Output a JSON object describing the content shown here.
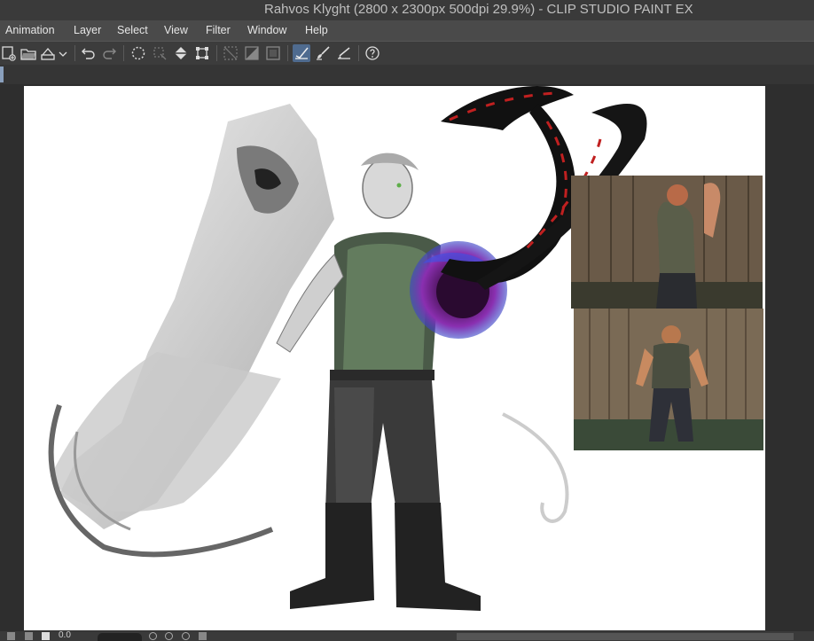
{
  "window": {
    "title": "Rahvos Klyght (2800 x 2300px 500dpi 29.9%)  - CLIP STUDIO PAINT EX"
  },
  "menu": {
    "items": [
      "Animation",
      "Layer",
      "Select",
      "View",
      "Filter",
      "Window",
      "Help"
    ]
  },
  "toolbar": {
    "icons": [
      "new-file-icon",
      "open-folder-icon",
      "save-icon",
      "dropdown-arrow-icon",
      "undo-icon",
      "redo-icon",
      "lasso-select-icon",
      "deselect-icon",
      "fill-icon",
      "transform-icon",
      "ruler-icon",
      "gradient-icon",
      "frame-icon",
      "pen-check-icon",
      "brush-icon",
      "correct-line-icon",
      "help-icon"
    ]
  },
  "statusbar": {
    "zoom_value": "0.0"
  },
  "colors": {
    "accent": "#4f6b8f",
    "canvas_bg": "#ffffff",
    "chrome_bg": "#3c3c3c"
  }
}
